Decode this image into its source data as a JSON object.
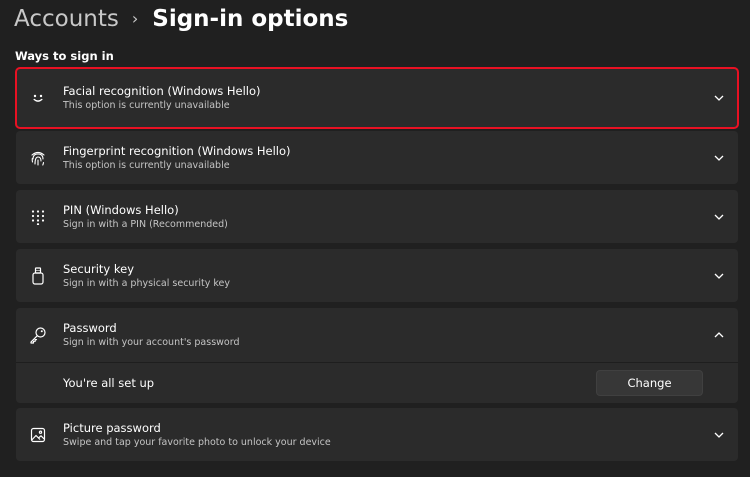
{
  "breadcrumb": {
    "parent": "Accounts",
    "separator": "›",
    "current": "Sign-in options"
  },
  "section": {
    "title": "Ways to sign in"
  },
  "options": [
    {
      "icon": "face-smile-icon",
      "title": "Facial recognition (Windows Hello)",
      "subtitle": "This option is currently unavailable",
      "expanded": false,
      "highlighted": true
    },
    {
      "icon": "fingerprint-icon",
      "title": "Fingerprint recognition (Windows Hello)",
      "subtitle": "This option is currently unavailable",
      "expanded": false
    },
    {
      "icon": "pin-keypad-icon",
      "title": "PIN (Windows Hello)",
      "subtitle": "Sign in with a PIN (Recommended)",
      "expanded": false
    },
    {
      "icon": "usb-key-icon",
      "title": "Security key",
      "subtitle": "Sign in with a physical security key",
      "expanded": false
    },
    {
      "icon": "key-icon",
      "title": "Password",
      "subtitle": "Sign in with your account's password",
      "expanded": true
    },
    {
      "icon": "picture-icon",
      "title": "Picture password",
      "subtitle": "Swipe and tap your favorite photo to unlock your device",
      "expanded": false
    }
  ],
  "password_detail": {
    "status": "You're all set up",
    "button_label": "Change"
  },
  "colors": {
    "background": "#202020",
    "card": "#2b2b2b",
    "highlight_border": "#e81123"
  }
}
